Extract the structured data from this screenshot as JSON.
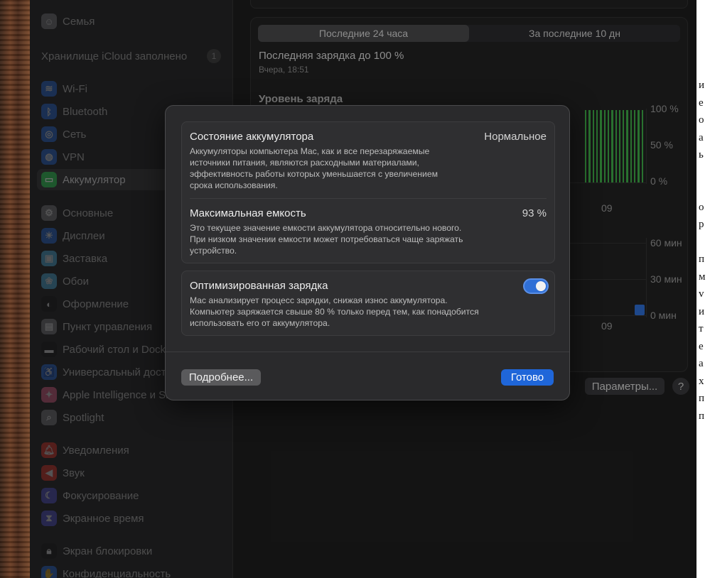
{
  "sidebar": {
    "top_item": {
      "label": "Семья",
      "icon": "family-icon",
      "color": "#8e8e93"
    },
    "icloud": {
      "label": "Хранилище iCloud заполнено",
      "badge": "1"
    },
    "group1": [
      {
        "label": "Wi-Fi",
        "icon": "wifi-icon",
        "color": "#2e7cf6",
        "glyph": "≋"
      },
      {
        "label": "Bluetooth",
        "icon": "bluetooth-icon",
        "color": "#2e7cf6",
        "glyph": "ᛒ"
      },
      {
        "label": "Сеть",
        "icon": "network-icon",
        "color": "#2e7cf6",
        "glyph": "◎"
      },
      {
        "label": "VPN",
        "icon": "vpn-icon",
        "color": "#2e7cf6",
        "glyph": "◍"
      },
      {
        "label": "Аккумулятор",
        "icon": "battery-icon",
        "color": "#34c759",
        "glyph": "▭"
      }
    ],
    "group2": [
      {
        "label": "Основные",
        "icon": "gear-icon",
        "color": "#8e8e93",
        "glyph": "⚙"
      },
      {
        "label": "Дисплеи",
        "icon": "display-icon",
        "color": "#2e7cf6",
        "glyph": "☀"
      },
      {
        "label": "Заставка",
        "icon": "screensaver-icon",
        "color": "#5ac8fa",
        "glyph": "▣"
      },
      {
        "label": "Обои",
        "icon": "wallpaper-icon",
        "color": "#5ac8fa",
        "glyph": "❀"
      },
      {
        "label": "Оформление",
        "icon": "appearance-icon",
        "color": "#1c1c1e",
        "glyph": "◐"
      },
      {
        "label": "Пункт управления",
        "icon": "control-center-icon",
        "color": "#8e8e93",
        "glyph": "▤"
      },
      {
        "label": "Рабочий стол и Dock",
        "icon": "desktop-dock-icon",
        "color": "#1c1c1e",
        "glyph": "▬"
      },
      {
        "label": "Универсальный доступ",
        "icon": "accessibility-icon",
        "color": "#2e7cf6",
        "glyph": "♿"
      },
      {
        "label": "Apple Intelligence и Siri",
        "icon": "siri-icon",
        "color": "#ff6b9a",
        "glyph": "✦"
      },
      {
        "label": "Spotlight",
        "icon": "spotlight-icon",
        "color": "#8e8e93",
        "glyph": "⌕"
      }
    ],
    "group3": [
      {
        "label": "Уведомления",
        "icon": "notifications-icon",
        "color": "#ff3b30",
        "glyph": "🔔︎"
      },
      {
        "label": "Звук",
        "icon": "sound-icon",
        "color": "#ff3b30",
        "glyph": "◀"
      },
      {
        "label": "Фокусирование",
        "icon": "focus-icon",
        "color": "#5e5ce6",
        "glyph": "☾"
      },
      {
        "label": "Экранное время",
        "icon": "screen-time-icon",
        "color": "#5e5ce6",
        "glyph": "⧗"
      }
    ],
    "group4": [
      {
        "label": "Экран блокировки",
        "icon": "lock-icon",
        "color": "#1c1c1e",
        "glyph": "🔒︎"
      },
      {
        "label": "Конфиденциальность",
        "icon": "privacy-icon",
        "color": "#2e7cf6",
        "glyph": "✋"
      }
    ]
  },
  "battery_panel": {
    "tabs": [
      "Последние 24 часа",
      "За последние 10 дн"
    ],
    "last_charge": "Последняя зарядка до 100 %",
    "last_charge_time": "Вчера, 18:51",
    "level_title": "Уровень заряда",
    "level_axis": [
      "100 %",
      "50 %",
      "0 %"
    ],
    "usage_axis": [
      "60 мин",
      "30 мин",
      "0 мин"
    ],
    "x_tick": "09",
    "params_button": "Параметры...",
    "help_button": "?"
  },
  "chart_data": [
    {
      "type": "bar",
      "title": "Уровень заряда",
      "ylabel": "",
      "ylim": [
        0,
        100
      ],
      "y_ticks": [
        "100 %",
        "50 %",
        "0 %"
      ],
      "x_tick": "09",
      "values": [
        100,
        100,
        100,
        100,
        100,
        100,
        100,
        100,
        100,
        100,
        100,
        100,
        100,
        100,
        100,
        100
      ],
      "color": "#3fae49"
    },
    {
      "type": "bar",
      "ylim": [
        0,
        60
      ],
      "y_ticks": [
        "60 мин",
        "30 мин",
        "0 мин"
      ],
      "x_tick": "09",
      "values": [
        9
      ],
      "color": "#2f6fd6"
    }
  ],
  "modal": {
    "health": {
      "title": "Состояние аккумулятора",
      "value": "Нормальное",
      "desc_lines": [
        "Аккумуляторы компьютера Mac, как и все перезаряжаемые",
        "источники питания, являются расходными материалами,",
        "эффективность работы которых уменьшается с увеличением",
        "срока использования."
      ]
    },
    "capacity": {
      "title": "Максимальная емкость",
      "value": "93 %",
      "desc_lines": [
        "Это текущее значение емкости аккумулятора относительно нового.",
        "При низком значении емкости может потребоваться чаще заряжать",
        "устройство."
      ]
    },
    "optimized": {
      "title": "Оптимизированная зарядка",
      "enabled": true,
      "desc_lines": [
        "Mac анализирует процесс зарядки, снижая износ аккумулятора.",
        "Компьютер заряжается свыше 80 % только перед тем, как понадобится",
        "использовать его от аккумулятора."
      ]
    },
    "more_button": "Подробнее...",
    "done_button": "Готово"
  },
  "doc_strip_chars": [
    "и",
    "е",
    "о",
    "а",
    "ь",
    "",
    "",
    "о",
    "р",
    "",
    "п",
    "м",
    "v",
    "и",
    "т",
    "е",
    "а",
    "х",
    "п",
    "п"
  ]
}
